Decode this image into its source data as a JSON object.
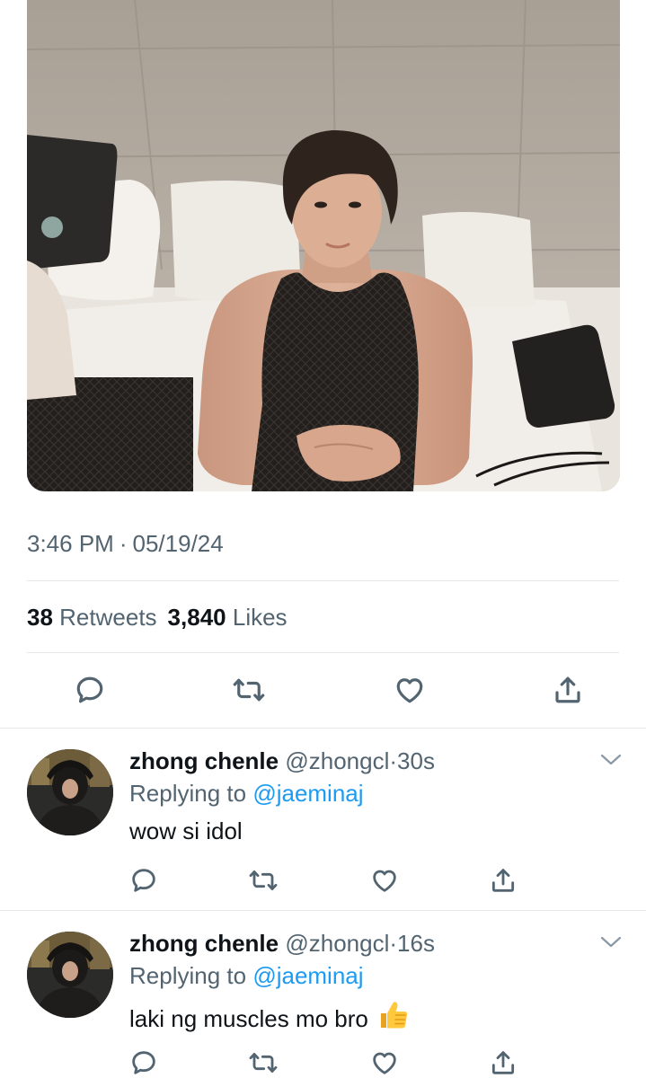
{
  "tweet": {
    "time": "3:46 PM",
    "separator": "·",
    "date": "05/19/24",
    "retweets_count": "38",
    "retweets_label": "Retweets",
    "likes_count": "3,840",
    "likes_label": "Likes"
  },
  "icons": {
    "reply": "speech-bubble-icon",
    "retweet": "retweet-arrows-icon",
    "like": "heart-outline-icon",
    "share": "share-upload-icon",
    "more": "chevron-down-icon"
  },
  "colors": {
    "text": "#0f1419",
    "muted": "#536471",
    "link": "#1d9bf0",
    "divider": "#e6e9eb"
  },
  "replies": [
    {
      "name": "zhong chenle",
      "handle": "@zhongcl",
      "dot": "·",
      "time": "30s",
      "replying_prefix": "Replying to",
      "replying_to": "@jaeminaj",
      "text": "wow si idol",
      "emoji": ""
    },
    {
      "name": "zhong chenle",
      "handle": "@zhongcl",
      "dot": "·",
      "time": "16s",
      "replying_prefix": "Replying to",
      "replying_to": "@jaeminaj",
      "text": "laki ng muscles mo bro",
      "emoji": "thumbs-up"
    }
  ]
}
